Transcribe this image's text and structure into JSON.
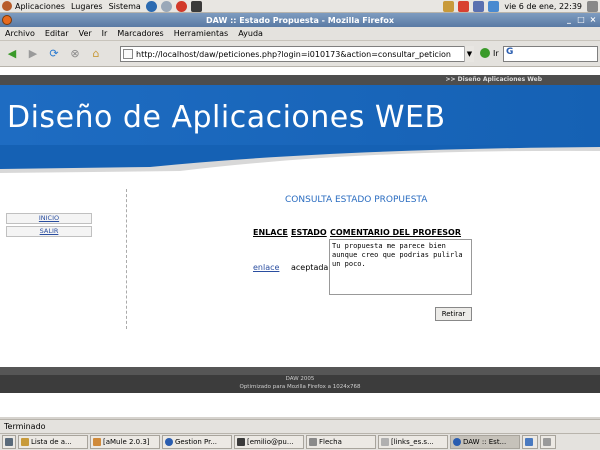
{
  "gnome_panel": {
    "menus": [
      "Aplicaciones",
      "Lugares",
      "Sistema"
    ],
    "clock": "vie  6 de ene, 22:39"
  },
  "window": {
    "title": "DAW :: Estado Propuesta - Mozilla Firefox",
    "controls": [
      "_",
      "□",
      "×"
    ]
  },
  "menubar": [
    "Archivo",
    "Editar",
    "Ver",
    "Ir",
    "Marcadores",
    "Herramientas",
    "Ayuda"
  ],
  "toolbar": {
    "url": "http://localhost/daw/peticiones.php?login=i010173&action=consultar_peticion",
    "go_label": "Ir",
    "search_label": "G"
  },
  "page": {
    "top_strip": ">> Diseño Aplicaciones Web",
    "banner_title": "Diseño de Aplicaciones WEB",
    "sidebar_links": [
      "INICIO",
      "SALIR"
    ],
    "section_title": "CONSULTA ESTADO PROPUESTA",
    "table": {
      "headers": [
        "ENLACE",
        "ESTADO",
        "COMENTARIO DEL PROFESOR"
      ],
      "row": {
        "enlace": "enlace",
        "estado": "aceptada",
        "comentario": "Tu propuesta me parece bien aunque creo que podrias pulirla un poco."
      }
    },
    "button_label": "Retirar",
    "footer_lines": [
      "DAW 2005",
      "Optimizado para Mozilla Firefox a 1024x768"
    ]
  },
  "statusbar": "Terminado",
  "taskbar": [
    "Lista de a...",
    "[aMule 2.0.3]",
    "Gestion Pr...",
    "[emilio@pu...",
    "Flecha",
    "[links_es.s...",
    "DAW :: Est..."
  ]
}
